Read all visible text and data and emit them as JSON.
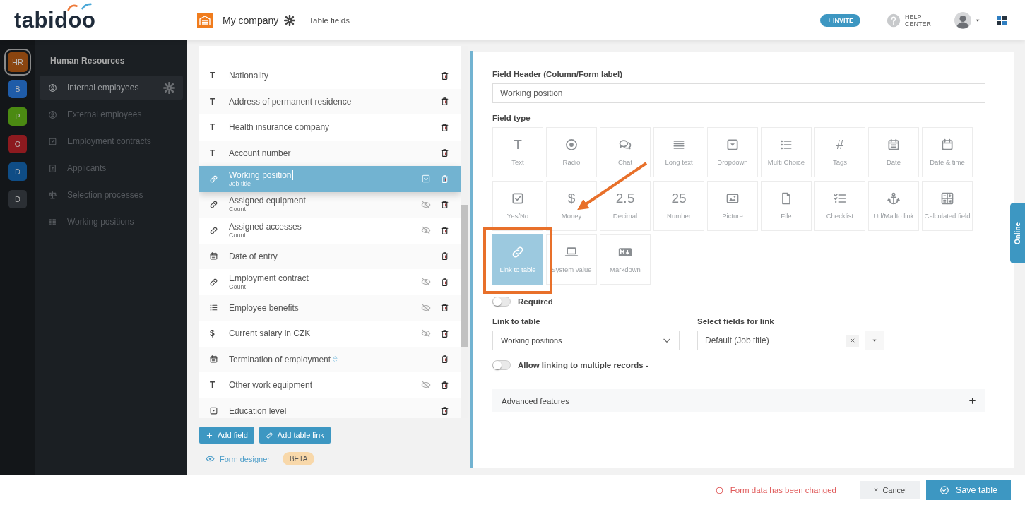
{
  "header": {
    "logo": "tabidoo",
    "company": "My company",
    "page": "Table fields",
    "invite": "+ INVITE",
    "help": "HELP CENTER"
  },
  "workspaces": [
    {
      "label": "HR",
      "color": "#8a4510",
      "selected": true
    },
    {
      "label": "B",
      "color": "#1f5ca8",
      "selected": false
    },
    {
      "label": "P",
      "color": "#4b8a12",
      "selected": false
    },
    {
      "label": "O",
      "color": "#8c1a1f",
      "selected": false
    },
    {
      "label": "D",
      "color": "#0f4d86",
      "selected": false
    },
    {
      "label": "D",
      "color": "#2b2f34",
      "selected": false
    }
  ],
  "sidebar": {
    "title": "Human Resources",
    "items": [
      {
        "label": "Internal employees",
        "kind": "person",
        "selected": true
      },
      {
        "label": "External employees",
        "kind": "person",
        "selected": false
      },
      {
        "label": "Employment contracts",
        "kind": "edit",
        "selected": false
      },
      {
        "label": "Applicants",
        "kind": "contact",
        "selected": false
      },
      {
        "label": "Selection processes",
        "kind": "scale",
        "selected": false
      },
      {
        "label": "Working positions",
        "kind": "pattern",
        "selected": false
      }
    ]
  },
  "fields": [
    {
      "kind": "text",
      "glyph": "T",
      "name": "Nationality",
      "hidden": false,
      "selected": false
    },
    {
      "kind": "text",
      "glyph": "T",
      "name": "Address of permanent residence",
      "hidden": false,
      "selected": false
    },
    {
      "kind": "text",
      "glyph": "T",
      "name": "Health insurance company",
      "hidden": false,
      "selected": false
    },
    {
      "kind": "text",
      "glyph": "T",
      "name": "Account number",
      "hidden": false,
      "selected": false
    },
    {
      "kind": "link",
      "name": "Working position",
      "sub": "Job title",
      "hidden": false,
      "selected": true
    },
    {
      "kind": "link",
      "name": "Assigned equipment",
      "sub": "Count",
      "hidden": true,
      "selected": false
    },
    {
      "kind": "link",
      "name": "Assigned accesses",
      "sub": "Count",
      "hidden": true,
      "selected": false
    },
    {
      "kind": "date",
      "name": "Date of entry",
      "hidden": false,
      "selected": false
    },
    {
      "kind": "link",
      "name": "Employment contract",
      "sub": "Count",
      "hidden": true,
      "selected": false
    },
    {
      "kind": "list",
      "name": "Employee benefits",
      "hidden": true,
      "selected": false
    },
    {
      "kind": "money",
      "glyph": "$",
      "name": "Current salary in CZK",
      "hidden": true,
      "selected": false
    },
    {
      "kind": "date",
      "name": "Termination of employment",
      "hidden": false,
      "selected": false,
      "sort_handle": true
    },
    {
      "kind": "text",
      "glyph": "T",
      "name": "Other work equipment",
      "hidden": true,
      "selected": false
    },
    {
      "kind": "dropdown",
      "name": "Education level",
      "hidden": false,
      "selected": false
    }
  ],
  "list_actions": {
    "add_field": "Add field",
    "add_link": "Add table link",
    "form_designer": "Form designer",
    "badge": "BETA"
  },
  "editor": {
    "header_label": "Field Header (Column/Form label)",
    "header_value": "Working position",
    "type_label": "Field type",
    "types": [
      {
        "kind": "text",
        "glyph": "T",
        "label": "Text",
        "selected": false,
        "callout": false
      },
      {
        "kind": "radio",
        "label": "Radio",
        "selected": false,
        "callout": false
      },
      {
        "kind": "chat",
        "label": "Chat",
        "selected": false,
        "callout": false
      },
      {
        "kind": "longtext",
        "label": "Long text",
        "selected": false,
        "callout": false
      },
      {
        "kind": "dropdown",
        "label": "Dropdown",
        "selected": false,
        "callout": false
      },
      {
        "kind": "list",
        "label": "Multi Choice",
        "selected": false,
        "callout": false
      },
      {
        "kind": "tags",
        "glyph": "#",
        "label": "Tags",
        "selected": false,
        "callout": false
      },
      {
        "kind": "date",
        "label": "Date",
        "selected": false,
        "callout": false
      },
      {
        "kind": "datetime",
        "label": "Date & time",
        "selected": false,
        "callout": false
      },
      {
        "kind": "checkbox",
        "label": "Yes/No",
        "selected": false,
        "callout": false
      },
      {
        "kind": "money",
        "glyph": "$",
        "label": "Money",
        "selected": false,
        "callout": false
      },
      {
        "kind": "decimal",
        "glyph": "2.5",
        "label": "Decimal",
        "selected": false,
        "callout": false
      },
      {
        "kind": "number",
        "glyph": "25",
        "label": "Number",
        "selected": false,
        "callout": false
      },
      {
        "kind": "picture",
        "label": "Picture",
        "selected": false,
        "callout": false
      },
      {
        "kind": "file",
        "label": "File",
        "selected": false,
        "callout": false
      },
      {
        "kind": "checklist",
        "label": "Checklist",
        "selected": false,
        "callout": false
      },
      {
        "kind": "anchor",
        "label": "Url/Mailto link",
        "selected": false,
        "callout": false
      },
      {
        "kind": "calculated",
        "label": "Calculated field",
        "selected": false,
        "callout": false
      },
      {
        "kind": "link",
        "label": "Link to table",
        "selected": true,
        "callout": true
      },
      {
        "kind": "system",
        "label": "System value",
        "selected": false,
        "callout": false
      },
      {
        "kind": "markdown",
        "label": "Markdown",
        "selected": false,
        "callout": false
      }
    ],
    "required": {
      "label": "Required",
      "on": false
    },
    "link_table": {
      "label": "Link to table",
      "value": "Working positions"
    },
    "link_fields": {
      "label": "Select fields for link",
      "value": "Default (Job title)"
    },
    "multiple": {
      "label": "Allow linking to multiple records -",
      "on": false
    },
    "advanced": {
      "label": "Advanced features",
      "expanded": false
    }
  },
  "footer": {
    "status": "Form data has been changed",
    "cancel": "Cancel",
    "save": "Save table"
  },
  "side_tab": "Online"
}
